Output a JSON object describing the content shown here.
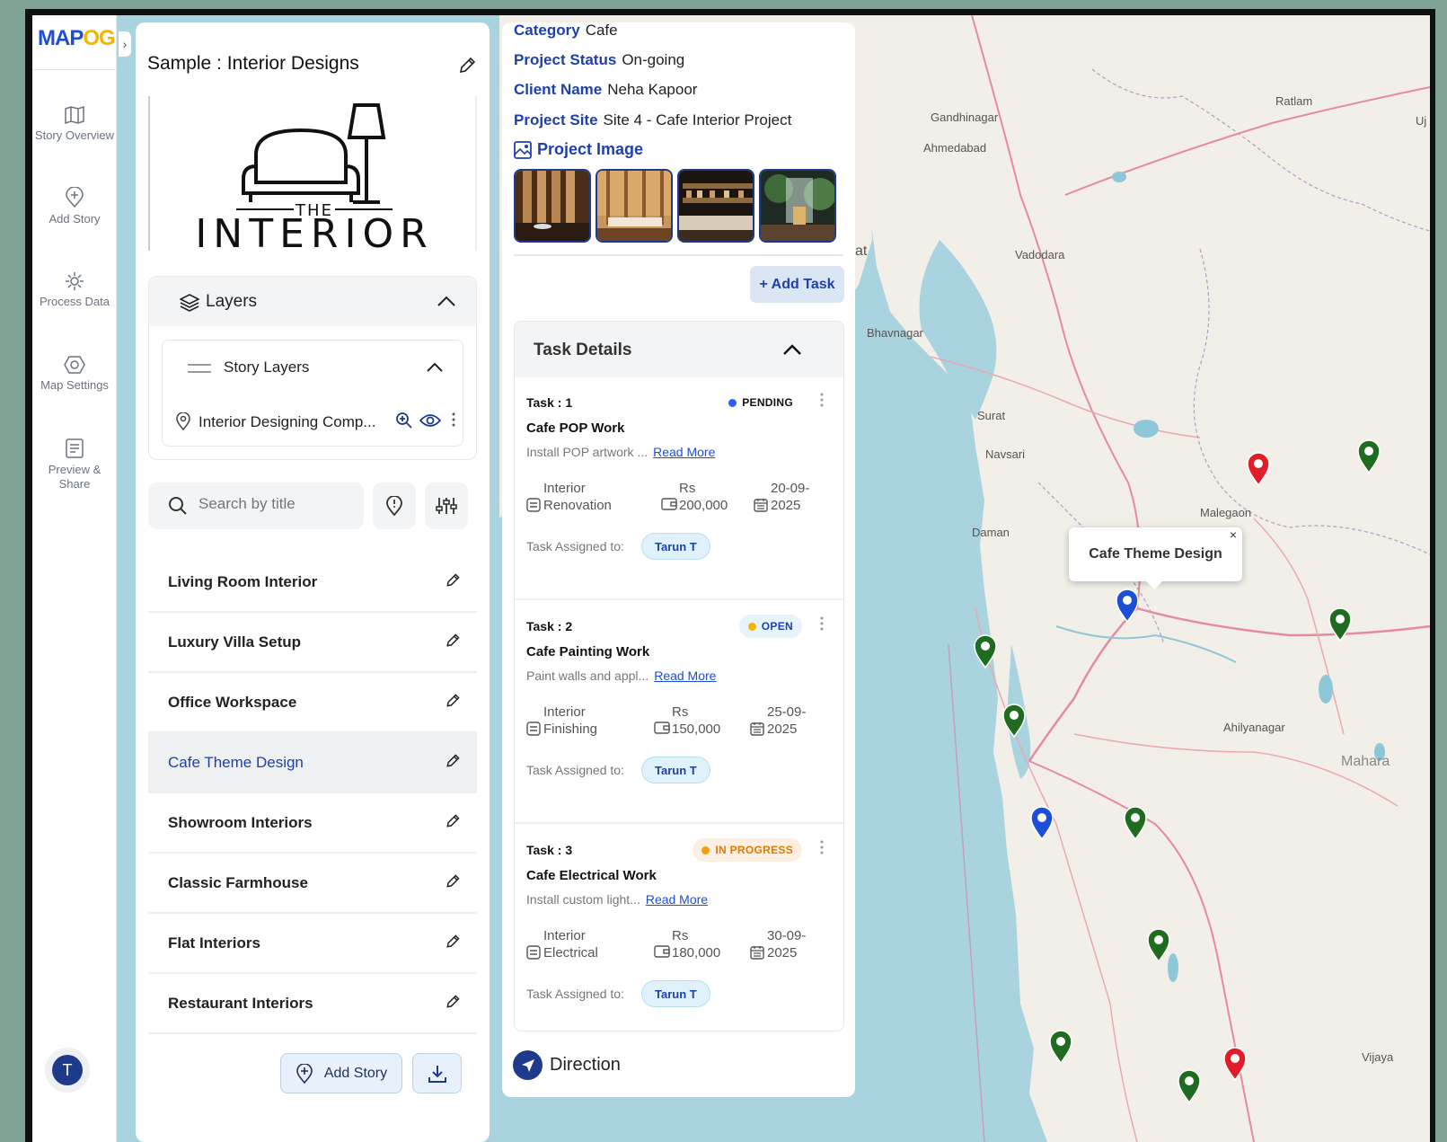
{
  "app": {
    "logo_main": "MAP",
    "logo_accent": "OG"
  },
  "rail": [
    {
      "label": "Story Overview",
      "icon": "map-icon"
    },
    {
      "label": "Add Story",
      "icon": "add-pin-icon"
    },
    {
      "label": "Process Data",
      "icon": "gear-icon"
    },
    {
      "label": "Map Settings",
      "icon": "settings-icon"
    },
    {
      "label": "Preview & Share",
      "icon": "preview-icon"
    }
  ],
  "user": {
    "initial": "T"
  },
  "story": {
    "title": "Sample : Interior Designs",
    "cover": {
      "the": "THE",
      "brand": "INTERIOR"
    },
    "layers": {
      "title": "Layers",
      "group": "Story Layers",
      "item": "Interior Designing Comp..."
    },
    "search_placeholder": "Search by title",
    "items": [
      {
        "title": "Living Room Interior"
      },
      {
        "title": "Luxury Villa Setup"
      },
      {
        "title": "Office Workspace"
      },
      {
        "title": "Cafe Theme Design"
      },
      {
        "title": "Showroom Interiors"
      },
      {
        "title": "Classic Farmhouse"
      },
      {
        "title": "Flat Interiors"
      },
      {
        "title": "Restaurant Interiors"
      }
    ],
    "active_item": "Cafe Theme Design",
    "add_story_label": "Add Story"
  },
  "detail": {
    "category": {
      "label": "Category",
      "value": "Cafe"
    },
    "status": {
      "label": "Project Status",
      "value": "On-going"
    },
    "client": {
      "label": "Client Name",
      "value": "Neha Kapoor"
    },
    "site": {
      "label": "Project Site",
      "value": "Site 4 - Cafe Interior Project"
    },
    "image_heading": "Project Image",
    "add_task_label": "+ Add Task",
    "tasks_heading": "Task Details",
    "assigned_label": "Task Assigned to:",
    "read_more": "Read More",
    "tasks": [
      {
        "num": "Task : 1",
        "status": "PENDING",
        "status_color": "#2563eb",
        "status_bg": "#ffffff",
        "status_fg": "#111111",
        "name": "Cafe POP Work",
        "desc": "Install POP artwork ...",
        "type_1": "Interior",
        "type_2": "Renovation",
        "cost_1": "Rs",
        "cost_2": "200,000",
        "date_1": "20-09-",
        "date_2": "2025",
        "assignee": "Tarun T"
      },
      {
        "num": "Task : 2",
        "status": "OPEN",
        "status_color": "#f5b400",
        "status_bg": "#e7f3fb",
        "status_fg": "#1e40af",
        "name": "Cafe Painting Work",
        "desc": "Paint walls and appl...",
        "type_1": "Interior",
        "type_2": "Finishing",
        "cost_1": "Rs",
        "cost_2": "150,000",
        "date_1": "25-09-",
        "date_2": "2025",
        "assignee": "Tarun T"
      },
      {
        "num": "Task : 3",
        "status": "IN PROGRESS",
        "status_color": "#f59e0b",
        "status_bg": "#fdf0e3",
        "status_fg": "#e07b00",
        "name": "Cafe Electrical Work",
        "desc": "Install custom light...",
        "type_1": "Interior",
        "type_2": "Electrical",
        "cost_1": "Rs",
        "cost_2": "180,000",
        "date_1": "30-09-",
        "date_2": "2025",
        "assignee": "Tarun T"
      }
    ],
    "direction_label": "Direction"
  },
  "map": {
    "popup_title": "Cafe Theme Design",
    "popup_close": "×",
    "places": [
      "Gandhinagar",
      "Ahmedabad",
      "Ratlam",
      "Vadodara",
      "Bhavnagar",
      "Surat",
      "Navsari",
      "Daman",
      "Malegaon",
      "Ahilyanagar",
      "Mahara",
      "Vijaya",
      "Uj",
      "at"
    ],
    "pin_colors": {
      "green": "#1f6b1f",
      "red": "#e11d2a",
      "blue": "#1d4ed8"
    }
  }
}
